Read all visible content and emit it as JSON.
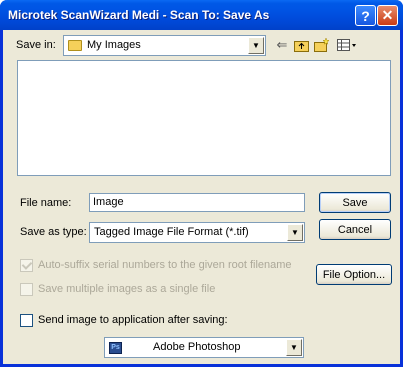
{
  "window": {
    "title": "Microtek ScanWizard Medi - Scan To: Save As",
    "help_glyph": "?",
    "close_glyph": "✕"
  },
  "save_in": {
    "label": "Save in:",
    "value": "My Images"
  },
  "toolbar_icons": [
    "back-arrow-icon",
    "up-folder-icon",
    "new-folder-icon",
    "view-menu-icon"
  ],
  "file_name": {
    "label": "File name:",
    "value": "Image"
  },
  "save_as_type": {
    "label": "Save as type:",
    "value": "Tagged Image File Format (*.tif)"
  },
  "buttons": {
    "save": "Save",
    "cancel": "Cancel",
    "file_option": "File Option..."
  },
  "options": {
    "auto_suffix": "Auto-suffix serial numbers to the given root filename",
    "save_multiple": "Save multiple images as a single file",
    "send_image": "Send image to application after saving:"
  },
  "application": {
    "value": "Adobe Photoshop",
    "icon_text": "Ps"
  },
  "colors": {
    "titlebar": "#0055e5",
    "dialog_bg": "#ece9d8",
    "disabled_text": "#aca899"
  }
}
